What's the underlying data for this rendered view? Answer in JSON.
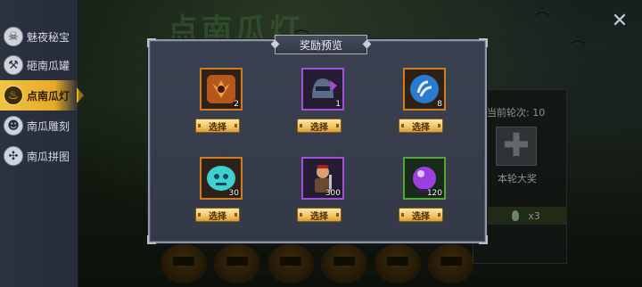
{
  "scene": {
    "title": "点南瓜灯"
  },
  "sidebar": {
    "items": [
      {
        "label": "魅夜秘宝",
        "icon": "skull-icon",
        "active": false
      },
      {
        "label": "砸南瓜罐",
        "icon": "hammer-icon",
        "active": false
      },
      {
        "label": "点南瓜灯",
        "icon": "lantern-icon",
        "active": true
      },
      {
        "label": "南瓜雕刻",
        "icon": "pumpkin-face-icon",
        "active": false
      },
      {
        "label": "南瓜拼图",
        "icon": "puzzle-icon",
        "active": false
      }
    ]
  },
  "close": {
    "icon": "close-icon"
  },
  "right_panel": {
    "round_label": "当前轮次: 10",
    "big_prize_label": "本轮大奖",
    "cost": "x3"
  },
  "popup": {
    "title": "奖励预览",
    "rewards": [
      {
        "count": "2",
        "icon": "orange-emblem-icon",
        "rarity": "orange",
        "button": "选择"
      },
      {
        "count": "1",
        "icon": "purple-helmet-icon",
        "rarity": "purple",
        "button": "选择"
      },
      {
        "count": "8",
        "icon": "blue-rune-icon",
        "rarity": "orange",
        "button": "选择"
      },
      {
        "count": "30",
        "icon": "cyan-skull-gem-icon",
        "rarity": "orange",
        "button": "选择"
      },
      {
        "count": "300",
        "icon": "hero-card-icon",
        "rarity": "purple",
        "button": "选择"
      },
      {
        "count": "120",
        "icon": "purple-orb-icon",
        "rarity": "green",
        "button": "选择"
      }
    ]
  },
  "colors": {
    "accent_gold": "#f2c443",
    "popup_bg": "#3a4150",
    "orange_rarity": "#cf7d1c",
    "purple_rarity": "#a34fd8",
    "green_rarity": "#55a63a"
  }
}
